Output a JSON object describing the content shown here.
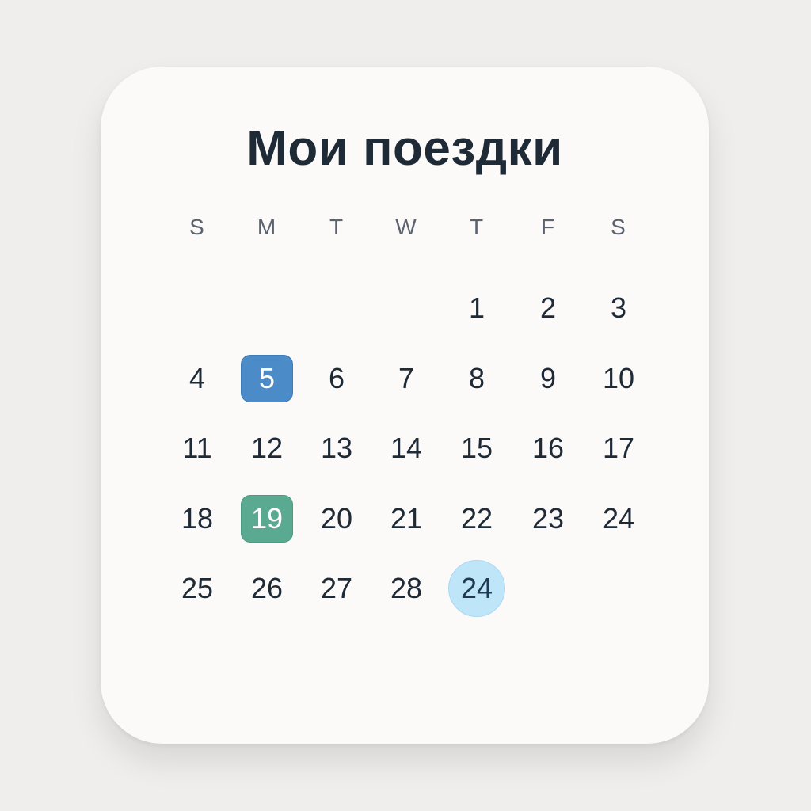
{
  "widget": {
    "title": "Мои поездки"
  },
  "weekdays": [
    "S",
    "M",
    "T",
    "W",
    "T",
    "F",
    "S"
  ],
  "weeks": [
    [
      "",
      "",
      "",
      "",
      "1",
      "2",
      "3"
    ],
    [
      "4",
      "5",
      "6",
      "7",
      "8",
      "9",
      "10"
    ],
    [
      "11",
      "12",
      "13",
      "14",
      "15",
      "16",
      "17"
    ],
    [
      "18",
      "19",
      "20",
      "21",
      "22",
      "23",
      "24"
    ],
    [
      "25",
      "26",
      "27",
      "28",
      "24",
      "",
      ""
    ]
  ],
  "highlights": {
    "blue": "#4a8bc8",
    "green": "#5aaa91",
    "light_blue": "#bfe5f9"
  }
}
